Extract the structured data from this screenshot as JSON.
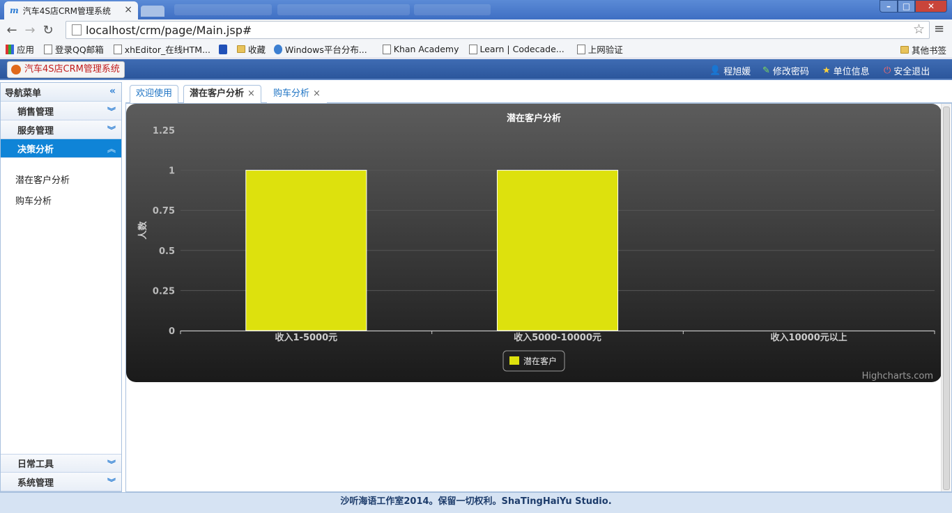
{
  "browser": {
    "tab_title": "汽车4S店CRM管理系统",
    "tab_close": "×",
    "url": "localhost/crm/page/Main.jsp#",
    "window_buttons": {
      "min": "–",
      "max": "□",
      "close": "✕"
    },
    "bookmarks": [
      {
        "label": "应用",
        "icon": "apps-icon"
      },
      {
        "label": "登录QQ邮箱",
        "icon": "page-icon"
      },
      {
        "label": "xhEditor_在线HTM...",
        "icon": "page-icon"
      },
      {
        "label": "",
        "icon": "paw-icon"
      },
      {
        "label": "收藏",
        "icon": "folder-icon"
      },
      {
        "label": "Windows平台分布...",
        "icon": "globe-icon"
      },
      {
        "label": "Khan Academy",
        "icon": "page-icon"
      },
      {
        "label": "Learn | Codecade...",
        "icon": "page-icon"
      },
      {
        "label": "上网验证",
        "icon": "page-icon"
      }
    ],
    "other_bookmarks": "其他书签"
  },
  "header": {
    "app_title": "汽车4S店CRM管理系统",
    "links": {
      "user": "程旭媛",
      "change_password": "修改密码",
      "unit_info": "单位信息",
      "logout": "安全退出"
    }
  },
  "sidebar": {
    "title": "导航菜单",
    "sections": [
      "销售管理",
      "服务管理",
      "决策分析"
    ],
    "selected_section": "决策分析",
    "sub_items": [
      "潜在客户分析",
      "购车分析"
    ],
    "bottom_sections": [
      "日常工具",
      "系统管理"
    ]
  },
  "tabs": [
    {
      "label": "欢迎使用",
      "closable": false
    },
    {
      "label": "潜在客户分析",
      "closable": true,
      "active": true
    },
    {
      "label": "购车分析",
      "closable": true
    }
  ],
  "tab_close": "×",
  "chart_data": {
    "type": "bar",
    "title": "潜在客户分析",
    "ylabel": "人数",
    "xlabel": "",
    "categories": [
      "收入1-5000元",
      "收入5000-10000元",
      "收入10000元以上"
    ],
    "series": [
      {
        "name": "潜在客户",
        "values": [
          1,
          1,
          0
        ],
        "color": "#dde10d"
      }
    ],
    "ylim": [
      0,
      1.25
    ],
    "yticks": [
      "0",
      "0.25",
      "0.5",
      "0.75",
      "1",
      "1.25"
    ],
    "grid": true,
    "legend": "bottom-center",
    "credits": "Highcharts.com"
  },
  "footer": "沙听海语工作室2014。保留一切权利。ShaTingHaiYu Studio."
}
